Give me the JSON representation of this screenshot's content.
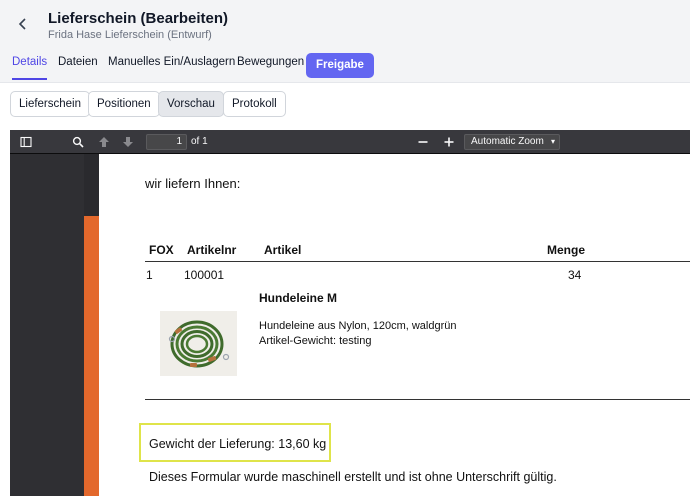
{
  "header": {
    "title": "Lieferschein (Bearbeiten)",
    "subtitle": "Frida Hase Lieferschein (Entwurf)"
  },
  "tabs": [
    {
      "label": "Details",
      "active": true
    },
    {
      "label": "Dateien",
      "active": false
    },
    {
      "label": "Manuelles Ein/Auslagern",
      "active": false
    },
    {
      "label": "Bewegungen",
      "active": false
    }
  ],
  "release_button": "Freigabe",
  "subtabs": [
    {
      "label": "Lieferschein",
      "active": false
    },
    {
      "label": "Positionen",
      "active": false
    },
    {
      "label": "Vorschau",
      "active": true
    },
    {
      "label": "Protokoll",
      "active": false
    }
  ],
  "pdf_toolbar": {
    "page_number": "1",
    "page_of": "of 1",
    "zoom": "Automatic Zoom",
    "icons": [
      "sidebar-toggle-icon",
      "search-icon",
      "arrow-up-icon",
      "arrow-down-icon",
      "zoom-out-icon",
      "zoom-in-icon"
    ]
  },
  "document": {
    "greeting": "wir liefern Ihnen:",
    "columns": [
      "FOX",
      "Artikelnr",
      "Artikel",
      "Menge"
    ],
    "rows": [
      {
        "pos": "1",
        "article_no": "100001",
        "quantity": "34",
        "name": "Hundeleine M",
        "description": "Hundeleine aus Nylon, 120cm, waldgrün",
        "weight_note": "Artikel-Gewicht: testing"
      }
    ],
    "total_weight": "Gewicht der Lieferung: 13,60 kg",
    "footer": "Dieses Formular wurde maschinell erstellt und ist ohne Unterschrift gültig."
  },
  "colors": {
    "accent": "#6366f1",
    "active_tab": "#4f46e5",
    "orange_margin": "#e3682c",
    "highlight": "#dfe44a",
    "viewer_bg": "#2a2a2e",
    "leash_green": "#3f6b2c",
    "leash_brown": "#b5713d"
  }
}
